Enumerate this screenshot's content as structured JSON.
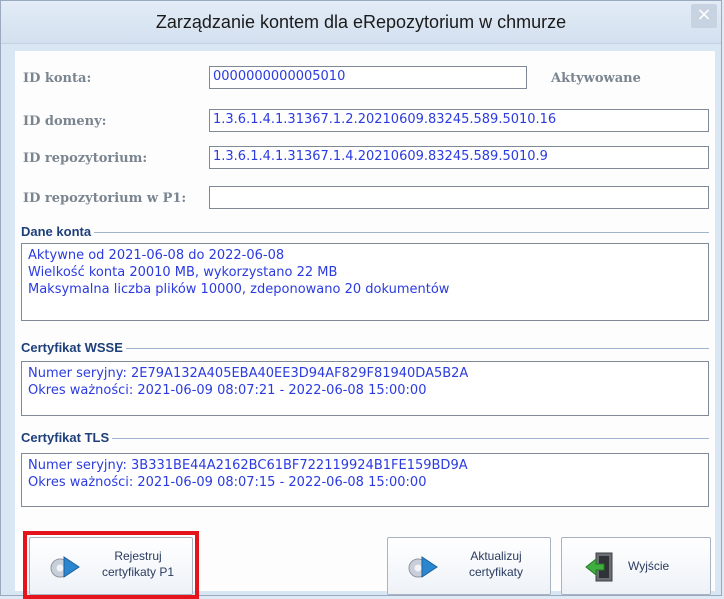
{
  "window": {
    "title": "Zarządzanie kontem dla eRepozytorium w chmurze",
    "close_glyph": "×"
  },
  "form": {
    "account_id": {
      "label": "ID konta:",
      "value": "0000000000005010",
      "status": "Aktywowane"
    },
    "domain_id": {
      "label": "ID domeny:",
      "value": "1.3.6.1.4.1.31367.1.2.20210609.83245.589.5010.16"
    },
    "repository_id": {
      "label": "ID repozytorium:",
      "value": "1.3.6.1.4.1.31367.1.4.20210609.83245.589.5010.9"
    },
    "repository_p1": {
      "label": "ID repozytorium w P1:",
      "value": ""
    }
  },
  "account_data": {
    "title": "Dane konta",
    "lines": [
      "Aktywne od 2021-06-08 do 2022-06-08",
      "Wielkość konta 20010 MB, wykorzystano 22 MB",
      "Maksymalna liczba plików 10000, zdeponowano 20 dokumentów"
    ]
  },
  "wsse": {
    "title": "Certyfikat WSSE",
    "lines": [
      "Numer seryjny: 2E79A132A405EBA40EE3D94AF829F81940DA5B2A",
      "Okres ważności: 2021-06-09 08:07:21 - 2022-06-08 15:00:00"
    ]
  },
  "tls": {
    "title": "Certyfikat TLS",
    "lines": [
      "Numer seryjny: 3B331BE44A2162BC61BF722119924B1FE159BD9A",
      "Okres ważności: 2021-06-09 08:07:15 - 2022-06-08 15:00:00"
    ]
  },
  "buttons": {
    "register": {
      "line1": "Rejestruj",
      "line2": "certyfikaty P1",
      "icon": "gear-play-icon"
    },
    "update": {
      "line1": "Aktualizuj",
      "line2": "certyfikaty",
      "icon": "gear-play-icon"
    },
    "exit": {
      "label": "Wyjście",
      "icon": "exit-door-icon"
    }
  },
  "colors": {
    "highlight": "#e5141c",
    "value_text": "#2b3be0",
    "group_title": "#1e3f7a"
  }
}
